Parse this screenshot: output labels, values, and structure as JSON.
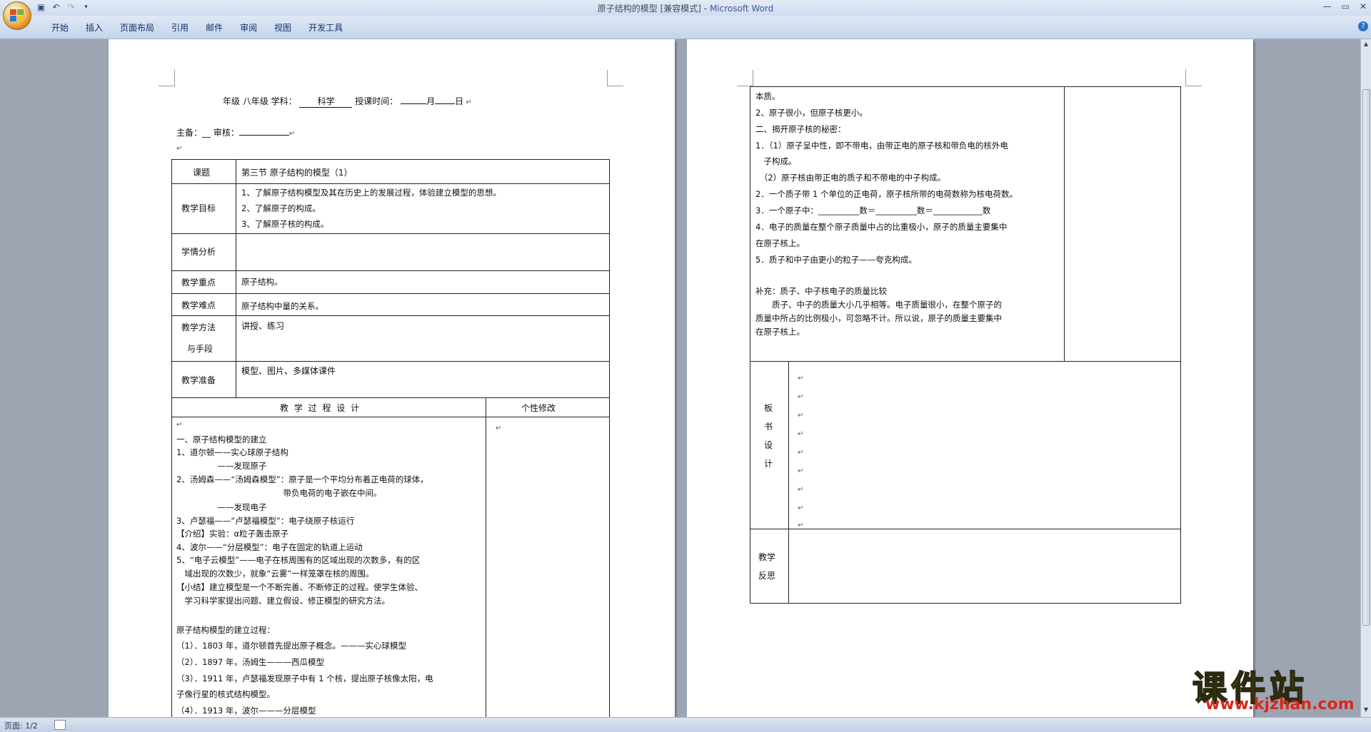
{
  "window": {
    "doc_name": "原子结构的模型 [兼容模式]",
    "separator": " - ",
    "app_name": "Microsoft Word"
  },
  "ribbon": {
    "tabs": [
      "开始",
      "插入",
      "页面布局",
      "引用",
      "邮件",
      "审阅",
      "视图",
      "开发工具"
    ]
  },
  "status": {
    "page": "页面: 1/2"
  },
  "watermark": {
    "big": "课件站",
    "small": "www.kjzhan.com"
  },
  "page1": {
    "header_line": "年级 八年级  学科：",
    "subject": "科学",
    "time_label": "授课时间：",
    "month": "月",
    "day": "日",
    "preparer": "主备：__   审核：",
    "rows": {
      "topic_label": "课题",
      "topic_value": "第三节   原子结构的模型（1）",
      "goal_label": "教学目标",
      "goals": [
        "1、了解原子结构模型及其在历史上的发展过程，体验建立模型的思想。",
        "2、了解原子的构成。",
        "3、了解原子核的构成。"
      ],
      "analysis_label": "学情分析",
      "key_label": "教学重点",
      "key_value": "原子结构。",
      "hard_label": "教学难点",
      "hard_value": "原子结构中量的关系。",
      "method_label_1": "教学方法",
      "method_label_2": "与手段",
      "method_value": "讲授、练习",
      "prep_label": "教学准备",
      "prep_value": "模型、图片、多媒体课件",
      "process_header": "教 学 过 程 设 计",
      "custom_header": "个性修改"
    },
    "process_lines": [
      "一、原子结构模型的建立",
      "1、道尔顿——实心球原子结构",
      "　　　　　——发现原子",
      "2、汤姆森——“汤姆森模型”：原子是一个平均分布着正电荷的球体，",
      "　　　　　　　　　　　　　带负电荷的电子嵌在中间。",
      "　　　　　——发现电子",
      "3、卢瑟福——“卢瑟福模型”：电子绕原子核运行",
      "【介绍】实验：α粒子轰击原子",
      "4、波尔——“分层模型”：电子在固定的轨道上运动",
      "5、“电子云模型”——电子在核周围有的区域出现的次数多，有的区",
      "　域出现的次数少，就象“云雾”一样笼罩在核的周围。",
      "【小结】建立模型是一个不断完善、不断修正的过程。使学生体验、",
      "　学习科学家提出问题、建立假设、修正模型的研究方法。",
      "",
      "原子结构模型的建立过程：",
      "（1）．1803 年，道尔顿首先提出原子概念。———实心球模型",
      "（2）．1897 年，汤姆生———西瓜模型",
      "（3）．1911 年，卢瑟福发现原子中有 1 个核，提出原子核像太阳，电",
      "子像行星的核式结构模型。",
      "（4）．1913 年，波尔———分层模型"
    ]
  },
  "page2": {
    "content_lines": [
      "本质。",
      "2、原子很小，但原子核更小。",
      "二、揭开原子核的秘密：",
      "1．（1）原子呈中性，即不带电，由带正电的原子核和带负电的核外电",
      "　子构成。",
      "　（2）原子核由带正电的质子和不带电的中子构成。",
      "2．一个质子带 1 个单位的正电荷，原子核所带的电荷数称为核电荷数。",
      "3．一个原子中：__________数＝__________数＝____________数",
      "4．电子的质量在整个原子质量中占的比重极小，原子的质量主要集中",
      "在原子核上。",
      "5．质子和中子由更小的粒子——夸克构成。",
      "",
      "补充：质子、中子核电子的质量比较",
      "　　质子、中子的质量大小几乎相等。电子质量很小，在整个原子的",
      "质量中所占的比例极小，可忽略不计。所以说，原子的质量主要集中",
      "在原子核上。"
    ],
    "board_label": [
      "板",
      "书",
      "设",
      "计"
    ],
    "reflect_label": [
      "教学",
      "反思"
    ]
  }
}
